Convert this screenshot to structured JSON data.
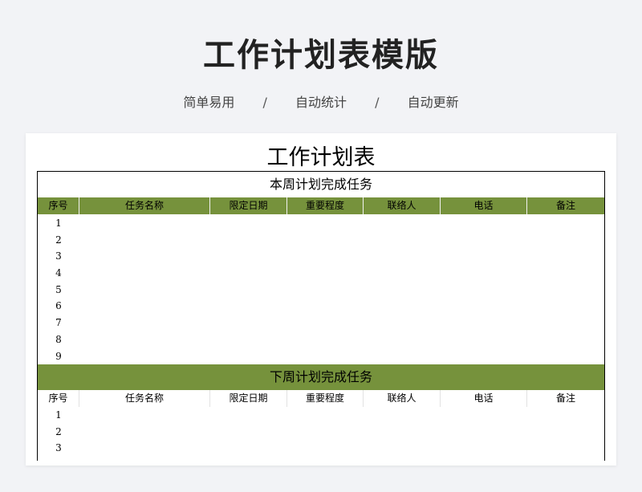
{
  "banner": {
    "title": "工作计划表模版",
    "tags": [
      "简单易用",
      "自动统计",
      "自动更新"
    ],
    "separator": "/"
  },
  "sheet": {
    "title": "工作计划表",
    "columns": [
      "序号",
      "任务名称",
      "限定日期",
      "重要程度",
      "联络人",
      "电话",
      "备注"
    ],
    "this_week": {
      "title": "本周计划完成任务",
      "rows": [
        "1",
        "2",
        "3",
        "4",
        "5",
        "6",
        "7",
        "8",
        "9"
      ]
    },
    "next_week": {
      "title": "下周计划完成任务",
      "rows": [
        "1",
        "2",
        "3"
      ]
    }
  },
  "colors": {
    "header_green": "#76923c",
    "background": "#f2f3f6"
  }
}
